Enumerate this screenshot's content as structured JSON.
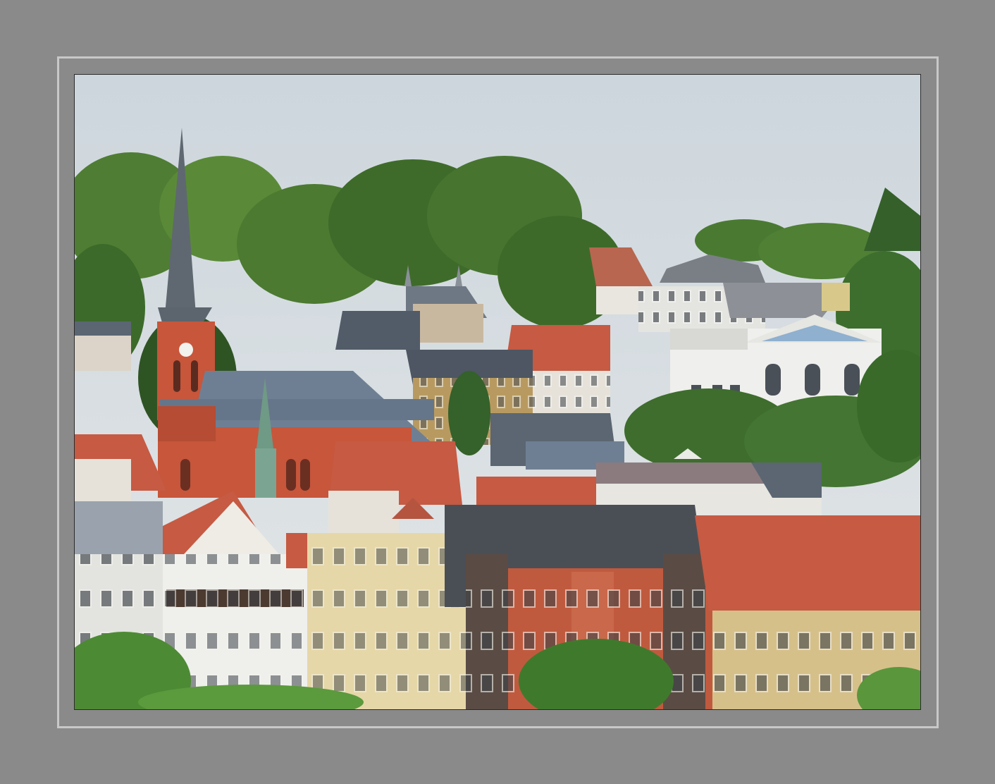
{
  "scene": {
    "subject": "hillside-town-with-church",
    "colors": {
      "background": "#8a8a8a",
      "mat_line": "#c8c8c8",
      "sky": "#d7dde2",
      "foliage_dark": "#3f6b2c",
      "foliage": "#5b8c3a",
      "foliage_light": "#7fae4e",
      "brick": "#c7563b",
      "brick_dark": "#a8442d",
      "roof_tile": "#c65a43",
      "roof_slate": "#5b6672",
      "roof_blue": "#6f7f93",
      "plaster_white": "#eeeeea",
      "plaster_cream": "#e6d7a8",
      "copper_green": "#6f9a86"
    }
  }
}
